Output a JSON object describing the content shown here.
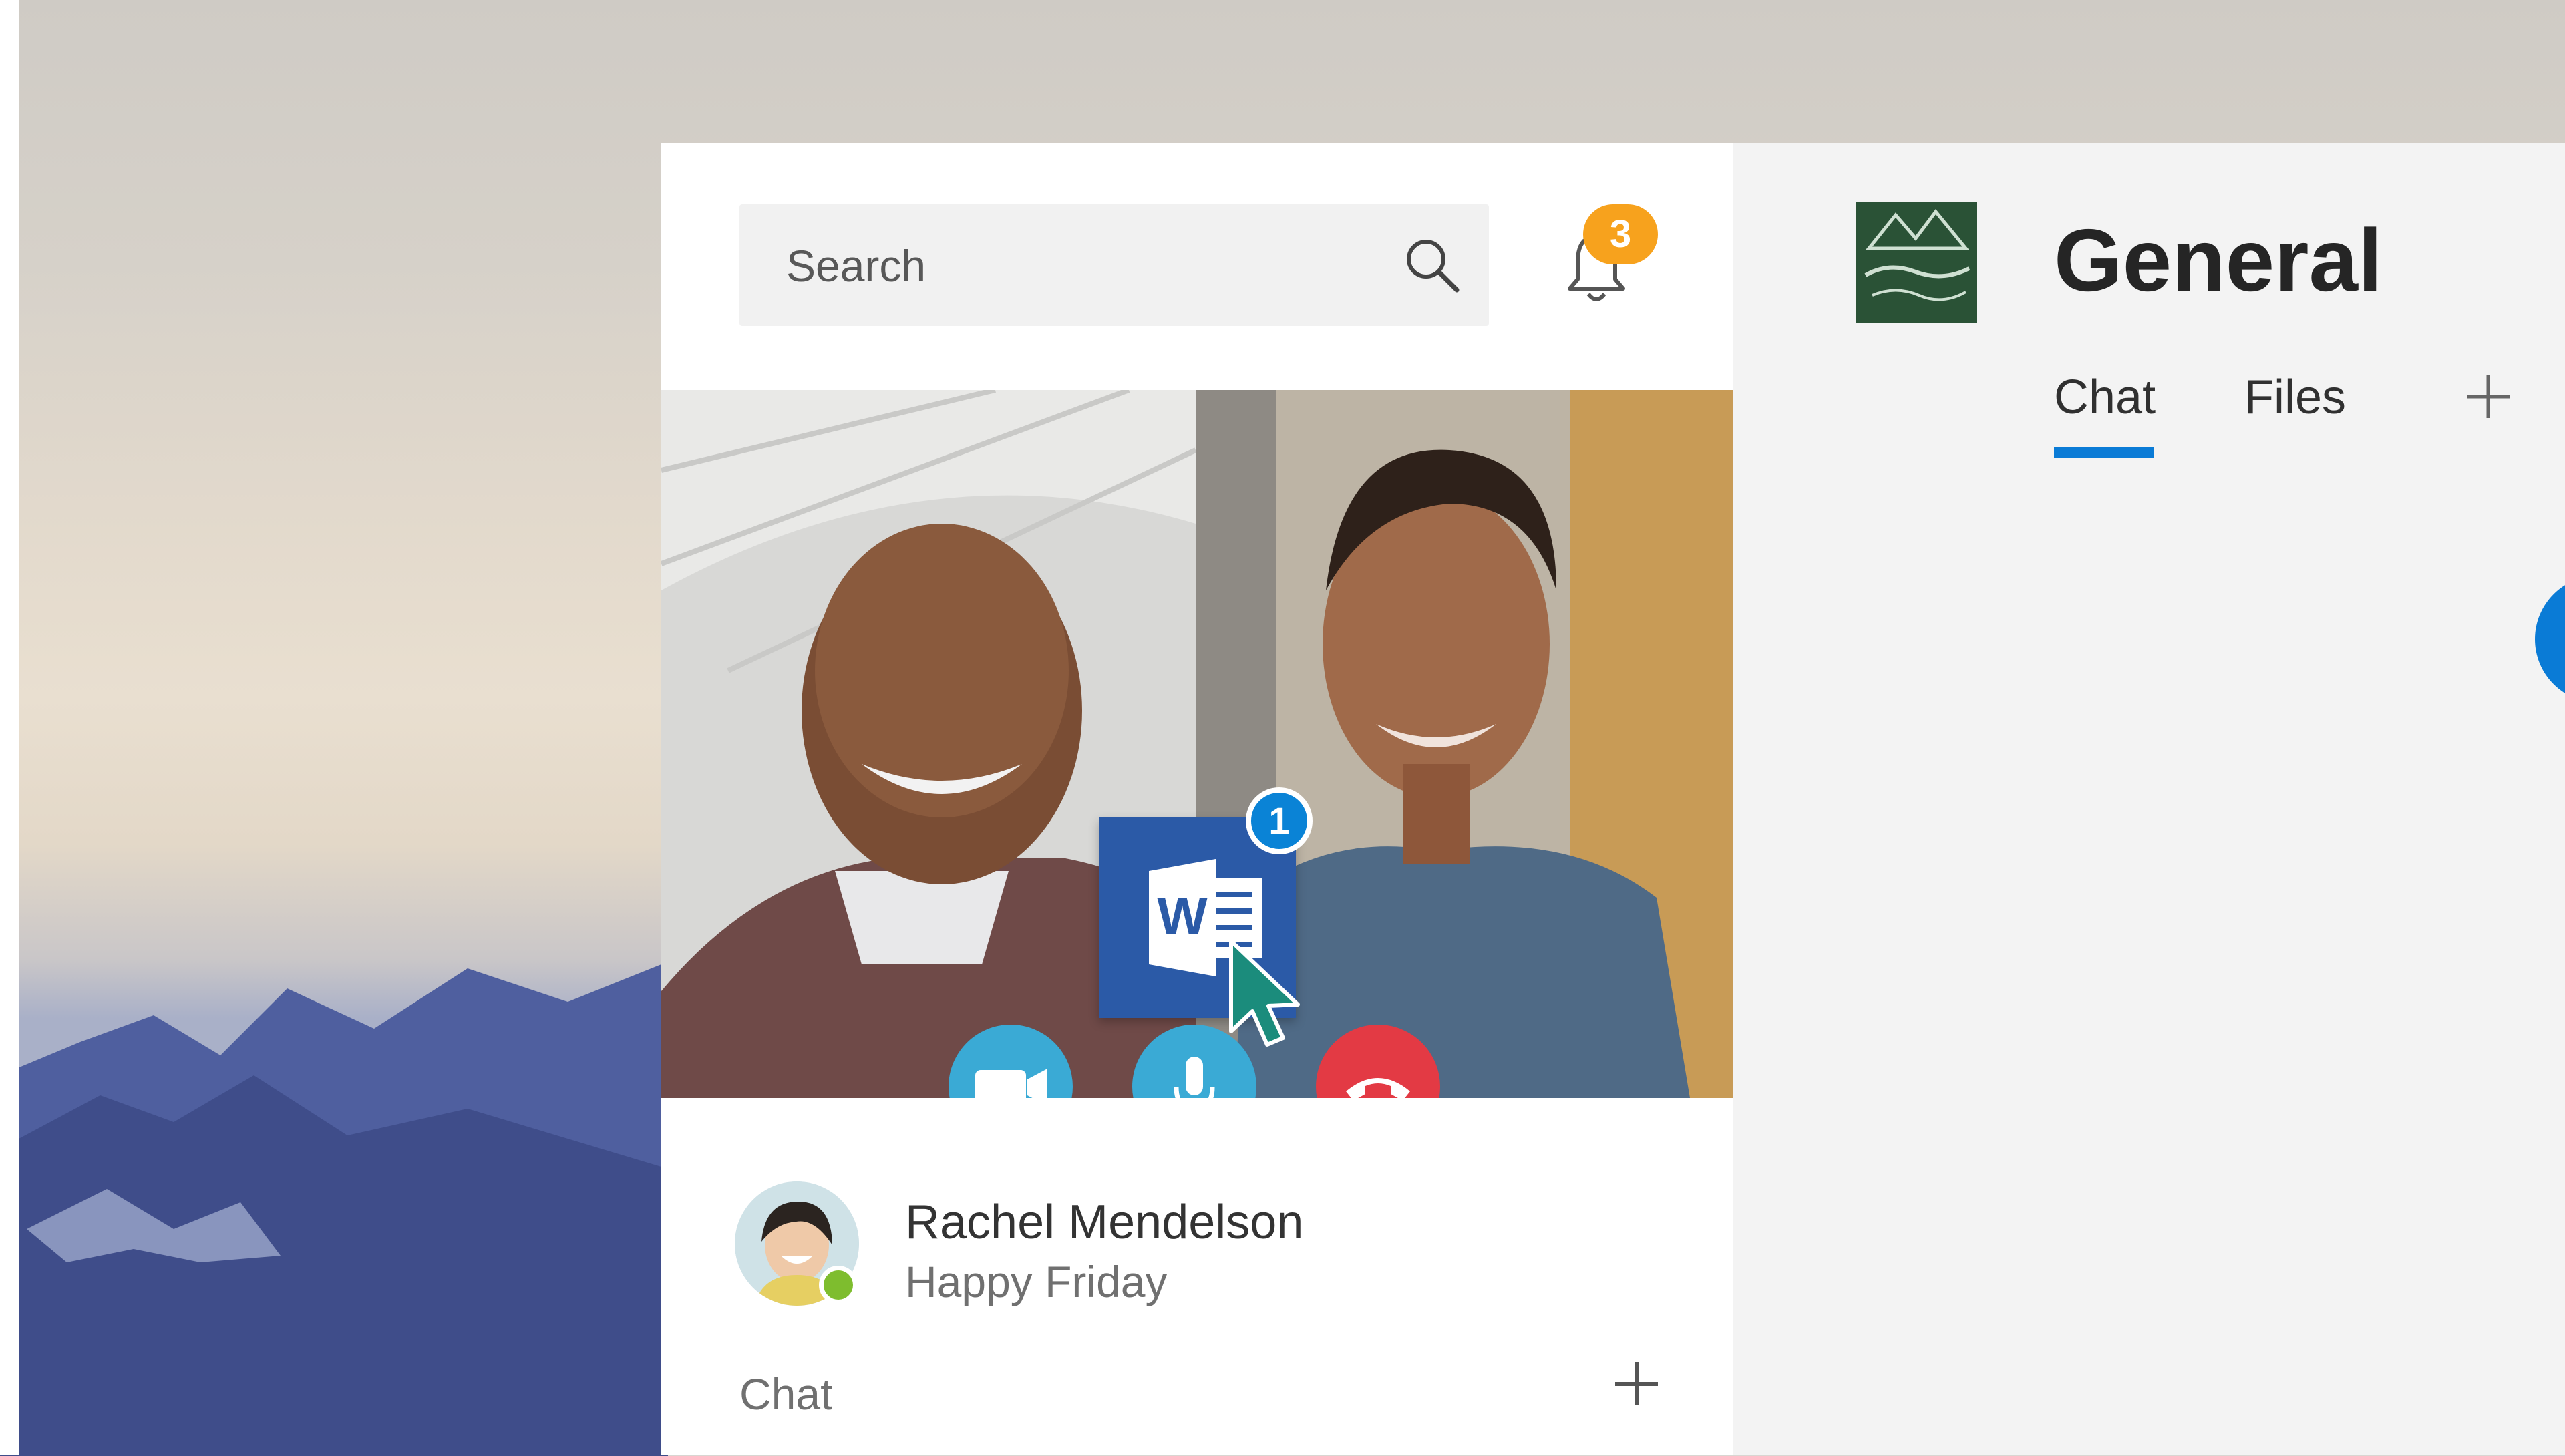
{
  "search": {
    "placeholder": "Search"
  },
  "notifications": {
    "count": "3"
  },
  "call": {
    "shared_file_badge": "1",
    "shared_file_letter": "W"
  },
  "contact": {
    "name": "Rachel Mendelson",
    "status": "Happy Friday"
  },
  "left_section": {
    "label": "Chat"
  },
  "channel": {
    "title": "General",
    "tabs": [
      {
        "label": "Chat"
      },
      {
        "label": "Files"
      }
    ]
  },
  "colors": {
    "accent": "#0a7bd6",
    "badge": "#f7a21d",
    "call_button": "#3aaad5",
    "hangup": "#e33a44",
    "word": "#2b5aa7"
  }
}
